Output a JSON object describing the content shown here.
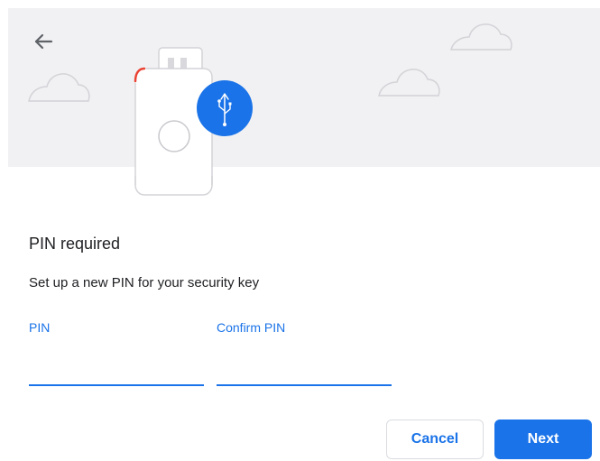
{
  "header": {
    "back_icon": "arrow-left-icon",
    "illustration_icon": "usb-icon",
    "background_color": "#f1f1f3"
  },
  "dialog": {
    "title": "PIN required",
    "subtitle": "Set up a new PIN for your security key"
  },
  "fields": {
    "pin_label": "PIN",
    "pin_value": "",
    "confirm_label": "Confirm PIN",
    "confirm_value": ""
  },
  "buttons": {
    "cancel_label": "Cancel",
    "next_label": "Next"
  },
  "colors": {
    "accent": "#1a73e8",
    "text": "#202124",
    "border": "#dadce0",
    "warning_mark": "#ea4335"
  }
}
